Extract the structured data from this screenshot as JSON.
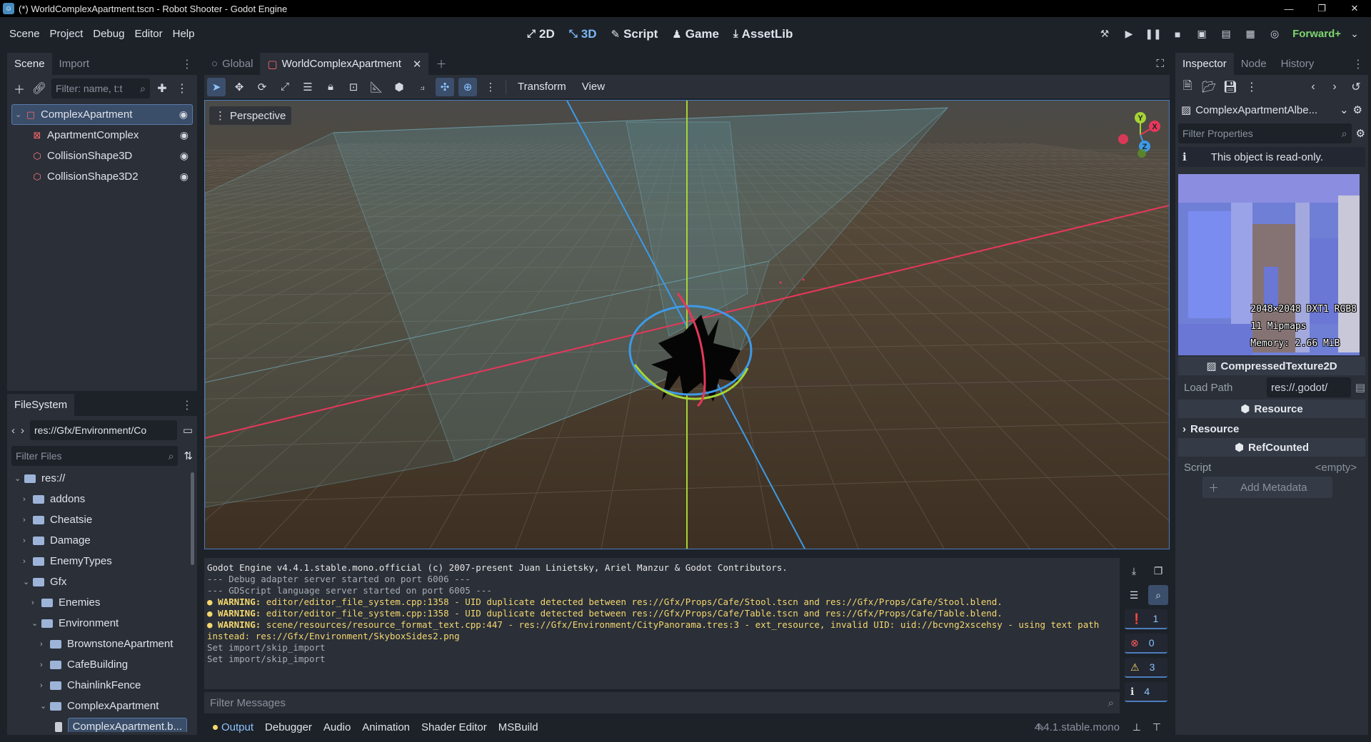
{
  "window": {
    "title": "(*) WorldComplexApartment.tscn - Robot Shooter - Godot Engine",
    "controls": [
      "—",
      "❐",
      "✕"
    ]
  },
  "menu": [
    "Scene",
    "Project",
    "Debug",
    "Editor",
    "Help"
  ],
  "modes": [
    {
      "label": "2D",
      "icon": "2d-icon"
    },
    {
      "label": "3D",
      "icon": "3d-icon",
      "active": true
    },
    {
      "label": "Script",
      "icon": "script-icon"
    },
    {
      "label": "Game",
      "icon": "game-icon"
    },
    {
      "label": "AssetLib",
      "icon": "assetlib-icon"
    }
  ],
  "renderer": "Forward+",
  "scene_dock": {
    "tabs": [
      "Scene",
      "Import"
    ],
    "filter_placeholder": "Filter: name, t:t",
    "nodes": [
      {
        "label": "ComplexApartment",
        "depth": 0,
        "selected": true,
        "color": "#ff6b6b"
      },
      {
        "label": "ApartmentComplex",
        "depth": 1,
        "color": "#ff6b6b"
      },
      {
        "label": "CollisionShape3D",
        "depth": 1,
        "color": "#ff7a7a"
      },
      {
        "label": "CollisionShape3D2",
        "depth": 1,
        "color": "#ff7a7a"
      }
    ]
  },
  "filesystem": {
    "tab": "FileSystem",
    "path": "res://Gfx/Environment/Co",
    "filter_placeholder": "Filter Files",
    "items": [
      {
        "label": "res://",
        "depth": 0,
        "arrow": "⌄"
      },
      {
        "label": "addons",
        "depth": 1,
        "arrow": "›"
      },
      {
        "label": "Cheatsie",
        "depth": 1,
        "arrow": "›"
      },
      {
        "label": "Damage",
        "depth": 1,
        "arrow": "›"
      },
      {
        "label": "EnemyTypes",
        "depth": 1,
        "arrow": "›"
      },
      {
        "label": "Gfx",
        "depth": 1,
        "arrow": "⌄"
      },
      {
        "label": "Enemies",
        "depth": 2,
        "arrow": "›"
      },
      {
        "label": "Environment",
        "depth": 2,
        "arrow": "⌄"
      },
      {
        "label": "BrownstoneApartment",
        "depth": 3,
        "arrow": "›"
      },
      {
        "label": "CafeBuilding",
        "depth": 3,
        "arrow": "›"
      },
      {
        "label": "ChainlinkFence",
        "depth": 3,
        "arrow": "›"
      },
      {
        "label": "ComplexApartment",
        "depth": 3,
        "arrow": "⌄"
      },
      {
        "label": "ComplexApartment.b...",
        "depth": 4,
        "arrow": "",
        "selected": true
      }
    ]
  },
  "editor": {
    "tabs": [
      {
        "label": "Global",
        "active": false
      },
      {
        "label": "WorldComplexApartment",
        "active": true
      }
    ],
    "toolbar_menus": [
      "Transform",
      "View"
    ],
    "viewport_label": "Perspective",
    "gizmo_labels": [
      "Y",
      "X",
      "Z"
    ]
  },
  "output": {
    "lines": [
      {
        "type": "normal",
        "text": "Godot Engine v4.4.1.stable.mono.official (c) 2007-present Juan Linietsky, Ariel Manzur & Godot Contributors."
      },
      {
        "type": "dim",
        "text": "--- Debug adapter server started on port 6006 ---"
      },
      {
        "type": "dim",
        "text": "--- GDScript language server started on port 6005 ---"
      },
      {
        "type": "warn",
        "prefix": "● WARNING:",
        "text": " editor/editor_file_system.cpp:1358 - UID duplicate detected between res://Gfx/Props/Cafe/Stool.tscn and res://Gfx/Props/Cafe/Stool.blend."
      },
      {
        "type": "warn",
        "prefix": "● WARNING:",
        "text": " editor/editor_file_system.cpp:1358 - UID duplicate detected between res://Gfx/Props/Cafe/Table.tscn and res://Gfx/Props/Cafe/Table.blend."
      },
      {
        "type": "warn",
        "prefix": "● WARNING:",
        "text": " scene/resources/resource_format_text.cpp:447 - res://Gfx/Environment/CityPanorama.tres:3 - ext_resource, invalid UID: uid://bcvng2xscehsy - using text path instead: res://Gfx/Environment/SkyboxSides2.png"
      },
      {
        "type": "dim",
        "text": "Set import/skip_import"
      },
      {
        "type": "dim",
        "text": "Set import/skip_import"
      }
    ],
    "counts": [
      {
        "icon": "message-icon",
        "value": "1",
        "color": "#e6e6e6"
      },
      {
        "icon": "error-icon",
        "value": "0",
        "color": "#ff5c5c"
      },
      {
        "icon": "warning-icon",
        "value": "3",
        "color": "#f5d76e"
      },
      {
        "icon": "info-icon",
        "value": "4",
        "color": "#e6e6e6"
      }
    ],
    "filter_placeholder": "Filter Messages",
    "bottom_tabs": [
      "Output",
      "Debugger",
      "Audio",
      "Animation",
      "Shader Editor",
      "MSBuild"
    ],
    "version": "4.4.1.stable.mono"
  },
  "inspector": {
    "tabs": [
      "Inspector",
      "Node",
      "History"
    ],
    "resource_name": "ComplexApartmentAlbe...",
    "filter_placeholder": "Filter Properties",
    "readonly_text": "This object is read-only.",
    "texture_info": [
      "2048×2048 DXT1 RGB8",
      "11 Mipmaps",
      "Memory: 2.66 MiB"
    ],
    "class_name": "CompressedTexture2D",
    "load_path_label": "Load Path",
    "load_path_value": "res://.godot/",
    "resource_section": "Resource",
    "resource_subsection": "Resource",
    "refcounted_section": "RefCounted",
    "script_label": "Script",
    "script_value": "<empty>",
    "add_metadata": "Add Metadata"
  }
}
